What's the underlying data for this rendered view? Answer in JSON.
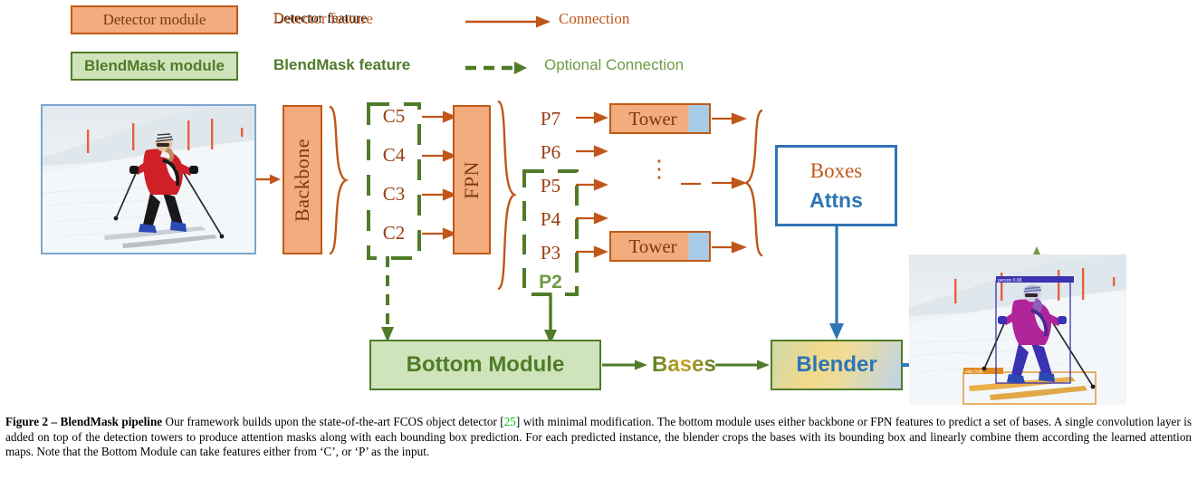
{
  "legend": {
    "detector_module": "Detector module",
    "blendmask_module": "BlendMask module",
    "detector_feature": "Detector feature",
    "blendmask_feature": "BlendMask feature",
    "connection": "Connection",
    "optional_connection": "Optional Connection"
  },
  "diagram": {
    "input_image_alt": "skier in red jacket on snow slope",
    "output_image_alt": "skier with segmentation masks and bounding boxes",
    "backbone": "Backbone",
    "fpn": "FPN",
    "tower_top": "Tower",
    "tower_bottom": "Tower",
    "vertical_dots": "⋮",
    "c_levels": [
      "C5",
      "C4",
      "C3",
      "C2"
    ],
    "p_levels": [
      "P7",
      "P6",
      "P5",
      "P4",
      "P3",
      "P2"
    ],
    "boxes_label": "Boxes",
    "attns_label": "Attns",
    "bottom_module": "Bottom Module",
    "bases": "Bases",
    "blender": "Blender"
  },
  "colors": {
    "detector_fill": "#f2ac7d",
    "detector_stroke": "#c05a15",
    "detector_text": "#7a3a10",
    "blendmask_fill": "#cfe4bb",
    "blendmask_stroke": "#4f7c28",
    "blendmask_text": "#4f7c28",
    "optional_connection": "#6f9a44",
    "blue_accent": "#2e75b6",
    "tower_attn_strip": "#a8cbe8",
    "reference_link": "#00c000"
  },
  "caption": {
    "figure_label": "Figure 2 – ",
    "figure_title": "BlendMask pipeline",
    "part1": " Our framework builds upon the state-of-the-art FCOS object detector [",
    "reference": "25",
    "part2": "] with minimal modification. The bottom module uses either backbone or FPN features to predict a set of bases. A single convolution layer is added on top of the detection towers to produce attention masks along with each bounding box prediction. For each predicted instance, the blender crops the bases with its bounding box and linearly combine them according the learned attention maps. Note that the Bottom Module can take features either from ‘C’, or ‘P’ as the input."
  }
}
